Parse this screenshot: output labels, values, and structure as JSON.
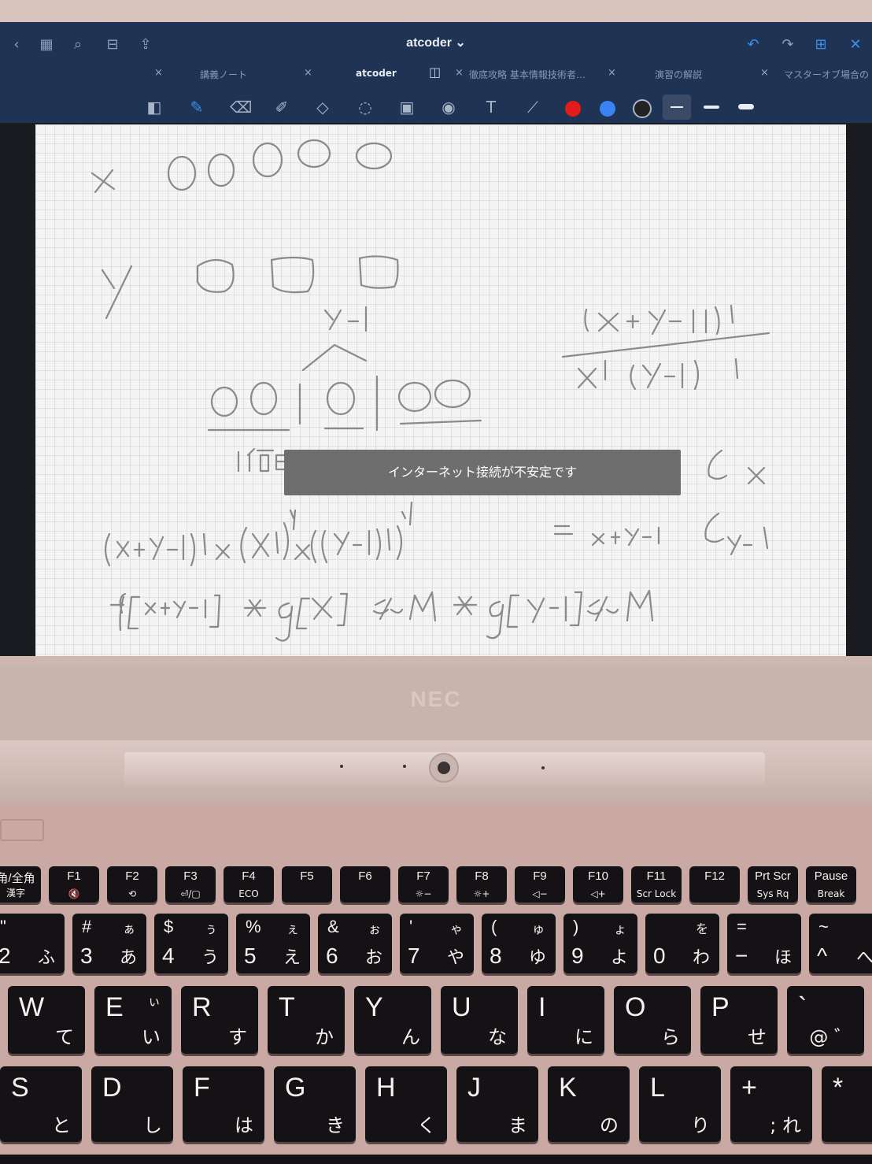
{
  "app": {
    "title": "atcoder ⌄",
    "tabs": [
      {
        "label": "講義ノート"
      },
      {
        "label": "atcoder"
      },
      {
        "label": "徹底攻略 基本情報技術者…"
      },
      {
        "label": "演習の解説"
      },
      {
        "label": "マスターオブ場合の"
      }
    ],
    "toolbar_icons": [
      "sidebar-icon",
      "pen-icon",
      "eraser-icon",
      "highlighter-icon",
      "shapes-icon",
      "lasso-icon",
      "image-icon",
      "camera-icon",
      "text-icon",
      "laser-icon"
    ],
    "colors": [
      "#e21b1b",
      "#3b82f6",
      "#222222"
    ],
    "accent": "#3b8ff0"
  },
  "notice": {
    "text": "インターネット接続が不安定です"
  },
  "brand": {
    "logo": "NEC"
  },
  "keyboard": {
    "function_row": [
      {
        "top": "角/全角",
        "bottom": "漢字"
      },
      {
        "top": "F1",
        "bottom": "🔇"
      },
      {
        "top": "F2",
        "bottom": "⟲"
      },
      {
        "top": "F3",
        "bottom": "⏎/▢"
      },
      {
        "top": "F4",
        "bottom": "ECO"
      },
      {
        "top": "F5",
        "bottom": ""
      },
      {
        "top": "F6",
        "bottom": ""
      },
      {
        "top": "F7",
        "bottom": "☼−"
      },
      {
        "top": "F8",
        "bottom": "☼+"
      },
      {
        "top": "F9",
        "bottom": "◁−"
      },
      {
        "top": "F10",
        "bottom": "◁+"
      },
      {
        "top": "F11",
        "bottom": "Scr Lock"
      },
      {
        "top": "F12",
        "bottom": ""
      },
      {
        "top": "Prt Scr",
        "bottom": "Sys Rq"
      },
      {
        "top": "Pause",
        "bottom": "Break"
      }
    ],
    "number_row": [
      {
        "sym": "\"",
        "kana_top": "",
        "num": "2",
        "kana": "ふ"
      },
      {
        "sym": "#",
        "kana_top": "ぁ",
        "num": "3",
        "kana": "あ"
      },
      {
        "sym": "$",
        "kana_top": "ぅ",
        "num": "4",
        "kana": "う"
      },
      {
        "sym": "%",
        "kana_top": "ぇ",
        "num": "5",
        "kana": "え"
      },
      {
        "sym": "&",
        "kana_top": "ぉ",
        "num": "6",
        "kana": "お"
      },
      {
        "sym": "'",
        "kana_top": "ゃ",
        "num": "7",
        "kana": "や"
      },
      {
        "sym": "(",
        "kana_top": "ゅ",
        "num": "8",
        "kana": "ゆ"
      },
      {
        "sym": ")",
        "kana_top": "ょ",
        "num": "9",
        "kana": "よ"
      },
      {
        "sym": "",
        "kana_top": "を",
        "num": "0",
        "kana": "わ"
      },
      {
        "sym": "=",
        "kana_top": "",
        "num": "−",
        "kana": "ほ"
      },
      {
        "sym": "~",
        "kana_top": "",
        "num": "^",
        "kana": "へ"
      }
    ],
    "qwerty_row": [
      {
        "letter": "W",
        "kana": "て",
        "kana_top": ""
      },
      {
        "letter": "E",
        "kana": "い",
        "kana_top": "ぃ"
      },
      {
        "letter": "R",
        "kana": "す",
        "kana_top": ""
      },
      {
        "letter": "T",
        "kana": "か",
        "kana_top": ""
      },
      {
        "letter": "Y",
        "kana": "ん",
        "kana_top": ""
      },
      {
        "letter": "U",
        "kana": "な",
        "kana_top": ""
      },
      {
        "letter": "I",
        "kana": "に",
        "kana_top": ""
      },
      {
        "letter": "O",
        "kana": "ら",
        "kana_top": ""
      },
      {
        "letter": "P",
        "kana": "せ",
        "kana_top": ""
      },
      {
        "letter": "`",
        "kana": "@ ゛",
        "kana_top": ""
      }
    ],
    "home_row": [
      {
        "letter": "S",
        "kana": "と"
      },
      {
        "letter": "D",
        "kana": "し"
      },
      {
        "letter": "F",
        "kana": "は"
      },
      {
        "letter": "G",
        "kana": "き"
      },
      {
        "letter": "H",
        "kana": "く"
      },
      {
        "letter": "J",
        "kana": "ま"
      },
      {
        "letter": "K",
        "kana": "の"
      },
      {
        "letter": "L",
        "kana": "り"
      },
      {
        "letter": "+",
        "kana": "; れ"
      },
      {
        "letter": "*",
        "kana": ":"
      }
    ]
  }
}
